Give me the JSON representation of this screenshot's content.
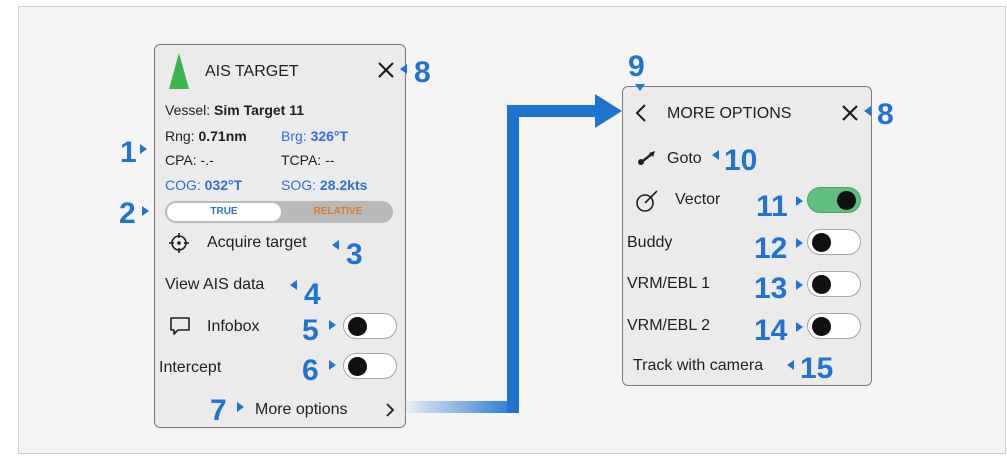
{
  "ais_panel": {
    "title": "AIS TARGET",
    "vessel_label": "Vessel:",
    "vessel_name": "Sim Target 11",
    "rng_label": "Rng:",
    "rng_value": "0.71nm",
    "brg_label": "Brg:",
    "brg_value": "326°T",
    "cpa_label": "CPA:",
    "cpa_value": "-.-",
    "tcpa_label": "TCPA:",
    "tcpa_value": "--",
    "cog_label": "COG:",
    "cog_value": "032°T",
    "sog_label": "SOG:",
    "sog_value": "28.2kts",
    "mode_true": "TRUE",
    "mode_relative": "RELATIVE",
    "acquire_target": "Acquire target",
    "view_ais_data": "View AIS data",
    "infobox": "Infobox",
    "intercept": "Intercept",
    "more_options": "More options",
    "infobox_on": false,
    "intercept_on": false
  },
  "more_panel": {
    "title": "MORE OPTIONS",
    "goto": "Goto",
    "vector": "Vector",
    "buddy": "Buddy",
    "vrm_ebl_1": "VRM/EBL 1",
    "vrm_ebl_2": "VRM/EBL 2",
    "track_with_camera": "Track with camera",
    "vector_on": true,
    "buddy_on": false,
    "vrm_ebl_1_on": false,
    "vrm_ebl_2_on": false
  },
  "callouts": {
    "c1": "1",
    "c2": "2",
    "c3": "3",
    "c4": "4",
    "c5": "5",
    "c6": "6",
    "c7": "7",
    "c8a": "8",
    "c8b": "8",
    "c9": "9",
    "c10": "10",
    "c11": "11",
    "c12": "12",
    "c13": "13",
    "c14": "14",
    "c15": "15"
  },
  "colors": {
    "callout": "#1f74d1",
    "toggle_on": "#5fbf7f",
    "vessel_icon": "#3bb54a",
    "relative": "#e07a2a",
    "value_blue": "#2f6fd6"
  }
}
